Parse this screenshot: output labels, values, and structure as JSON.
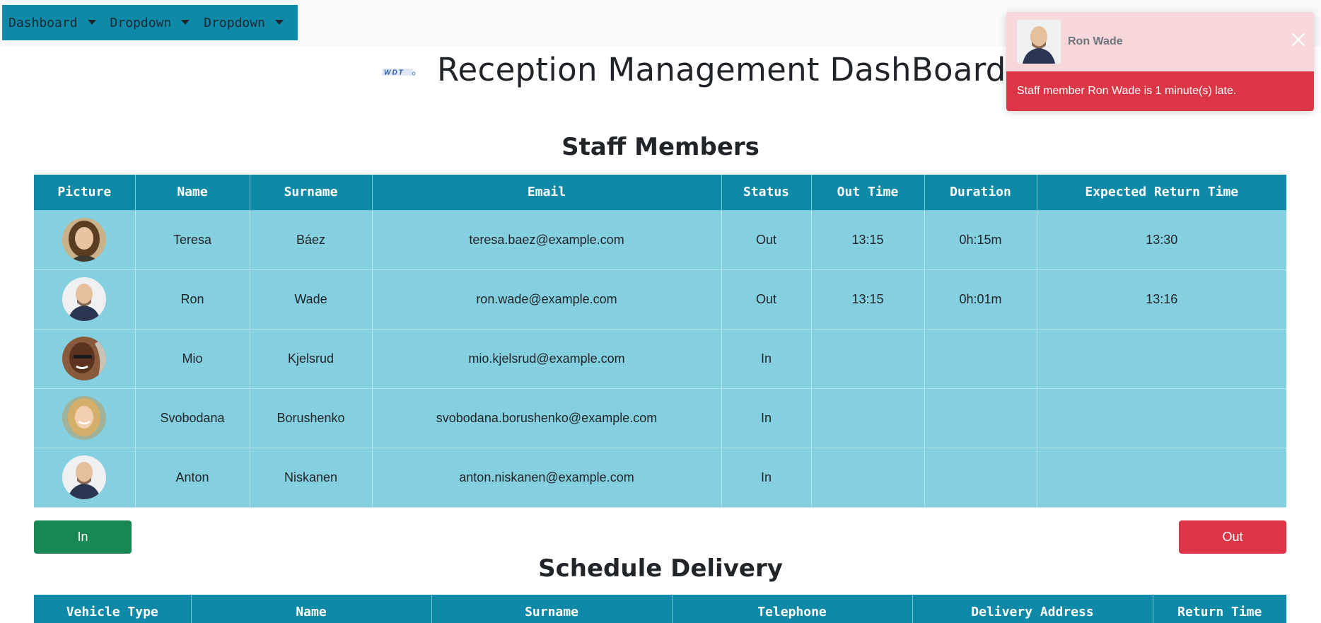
{
  "nav": {
    "items": [
      {
        "label": "Dashboard"
      },
      {
        "label": "Dropdown"
      },
      {
        "label": "Dropdown"
      }
    ]
  },
  "header": {
    "logo_text": "WDT",
    "title": "Reception Management DashBoard"
  },
  "staff": {
    "title": "Staff Members",
    "columns": [
      "Picture",
      "Name",
      "Surname",
      "Email",
      "Status",
      "Out Time",
      "Duration",
      "Expected Return Time"
    ],
    "rows": [
      {
        "name": "Teresa",
        "surname": "Báez",
        "email": "teresa.baez@example.com",
        "status": "Out",
        "out_time": "13:15",
        "duration": "0h:15m",
        "return_time": "13:30",
        "avatar": "woman-brown-hair"
      },
      {
        "name": "Ron",
        "surname": "Wade",
        "email": "ron.wade@example.com",
        "status": "Out",
        "out_time": "13:15",
        "duration": "0h:01m",
        "return_time": "13:16",
        "avatar": "bald-man"
      },
      {
        "name": "Mio",
        "surname": "Kjelsrud",
        "email": "mio.kjelsrud@example.com",
        "status": "In",
        "out_time": "",
        "duration": "",
        "return_time": "",
        "avatar": "man-dark-skin"
      },
      {
        "name": "Svobodana",
        "surname": "Borushenko",
        "email": "svobodana.borushenko@example.com",
        "status": "In",
        "out_time": "",
        "duration": "",
        "return_time": "",
        "avatar": "woman-blonde"
      },
      {
        "name": "Anton",
        "surname": "Niskanen",
        "email": "anton.niskanen@example.com",
        "status": "In",
        "out_time": "",
        "duration": "",
        "return_time": "",
        "avatar": "bald-man"
      }
    ]
  },
  "buttons": {
    "in_label": "In",
    "out_label": "Out",
    "in_color": "#198754",
    "out_color": "#dc3545"
  },
  "delivery": {
    "title": "Schedule Delivery",
    "columns": [
      "Vehicle Type",
      "Name",
      "Surname",
      "Telephone",
      "Delivery Address",
      "Return Time"
    ]
  },
  "toast": {
    "name": "Ron Wade",
    "message": "Staff member Ron Wade is 1 minute(s) late."
  },
  "colors": {
    "accent": "#0e8aa8",
    "row_bg": "#85d0e0",
    "danger": "#dc3545",
    "success": "#198754"
  }
}
